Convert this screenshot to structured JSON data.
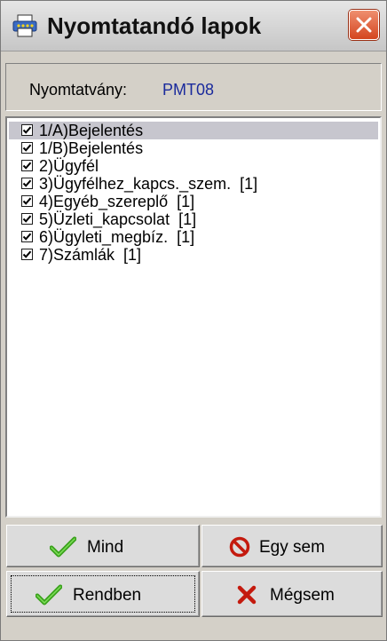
{
  "window": {
    "title": "Nyomtatandó lapok",
    "icon": "printer-icon",
    "close_icon": "close-icon"
  },
  "info": {
    "label": "Nyomtatvány:",
    "value": "PMT08"
  },
  "pages": [
    {
      "label": "1/A)Bejelentés",
      "checked": true,
      "selected": true
    },
    {
      "label": "1/B)Bejelentés",
      "checked": true,
      "selected": false
    },
    {
      "label": "2)Ügyfél",
      "checked": true,
      "selected": false
    },
    {
      "label": "3)Ügyfélhez_kapcs._szem.  [1]",
      "checked": true,
      "selected": false
    },
    {
      "label": "4)Egyéb_szereplő  [1]",
      "checked": true,
      "selected": false
    },
    {
      "label": "5)Üzleti_kapcsolat  [1]",
      "checked": true,
      "selected": false
    },
    {
      "label": "6)Ügyleti_megbíz.  [1]",
      "checked": true,
      "selected": false
    },
    {
      "label": "7)Számlák  [1]",
      "checked": true,
      "selected": false
    }
  ],
  "buttons": {
    "all": {
      "label": "Mind",
      "icon": "green-check-icon"
    },
    "none": {
      "label": "Egy sem",
      "icon": "no-entry-icon"
    },
    "ok": {
      "label": "Rendben",
      "icon": "green-check-icon"
    },
    "cancel": {
      "label": "Mégsem",
      "icon": "red-x-icon"
    }
  },
  "colors": {
    "accent_value": "#1a2a9c",
    "selection": "#c7c6ce",
    "close_button": "#d4451f",
    "check_green": "#3aa11c",
    "cancel_red": "#c41a0e"
  }
}
